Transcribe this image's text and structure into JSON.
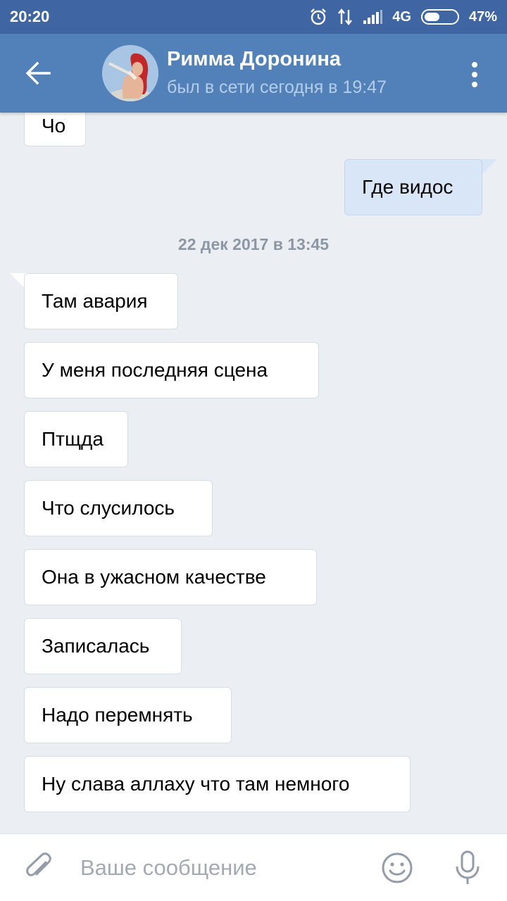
{
  "status_bar": {
    "time": "20:20",
    "network": "4G",
    "battery": "47%",
    "battery_level": 0.47
  },
  "header": {
    "contact_name": "Римма Доронина",
    "contact_status": "был в сети сегодня в 19:47"
  },
  "messages": [
    {
      "text": "Чо",
      "direction": "incoming"
    },
    {
      "text": "Где видос",
      "direction": "outgoing"
    },
    {
      "text": "Там авария",
      "direction": "incoming"
    },
    {
      "text": "У меня последняя сцена",
      "direction": "incoming"
    },
    {
      "text": "Птщда",
      "direction": "incoming"
    },
    {
      "text": "Что слусилось",
      "direction": "incoming"
    },
    {
      "text": "Она в ужасном качестве",
      "direction": "incoming"
    },
    {
      "text": "Записалась",
      "direction": "incoming"
    },
    {
      "text": "Надо перемнять",
      "direction": "incoming"
    },
    {
      "text": "Ну слава аллаху что там немного",
      "direction": "incoming"
    }
  ],
  "date_separator": "22 дек 2017 в 13:45",
  "composer": {
    "placeholder": "Ваше сообщение",
    "value": ""
  },
  "icons": {
    "back": "arrow-left-icon",
    "menu": "more-vertical-icon",
    "attach": "paperclip-icon",
    "emoji": "smiley-icon",
    "mic": "microphone-icon",
    "alarm": "alarm-clock-icon",
    "data": "data-arrows-icon",
    "signal": "signal-icon",
    "battery": "battery-icon"
  },
  "colors": {
    "status_bar": "#3f66a3",
    "header": "#5181b8",
    "background": "#ebeff4",
    "incoming_bubble": "#ffffff",
    "outgoing_bubble": "#d9e6f7"
  }
}
